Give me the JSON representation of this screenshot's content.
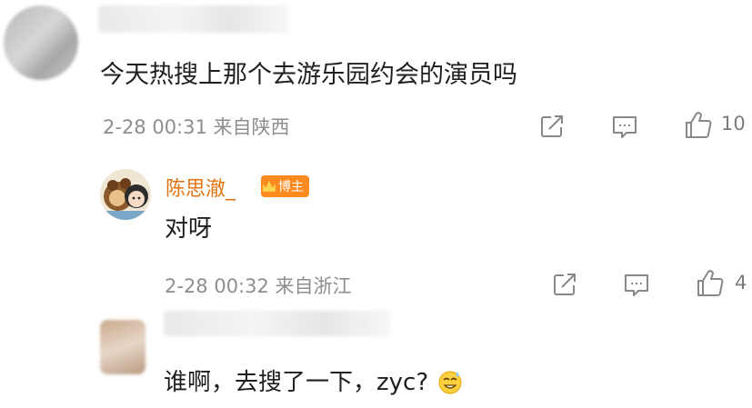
{
  "comments": [
    {
      "text": "今天热搜上那个去游乐园约会的演员吗",
      "meta": "2-28 00:31 来自陕西",
      "likes": "10",
      "icons": [
        "share-icon",
        "comment-icon",
        "like-icon"
      ]
    },
    {
      "author": "陈思澈_",
      "badge": "博主",
      "text": "对呀",
      "meta": "2-28 00:32 来自浙江",
      "likes": "4",
      "icons": [
        "share-icon",
        "comment-icon",
        "like-icon"
      ]
    },
    {
      "text": "谁啊，去搜了一下，zyc?"
    }
  ],
  "colors": {
    "author_name": "#e4720f",
    "badge_bg": "#ff8a1f",
    "meta_text": "#8e8e8e",
    "icon_stroke": "#888888"
  }
}
